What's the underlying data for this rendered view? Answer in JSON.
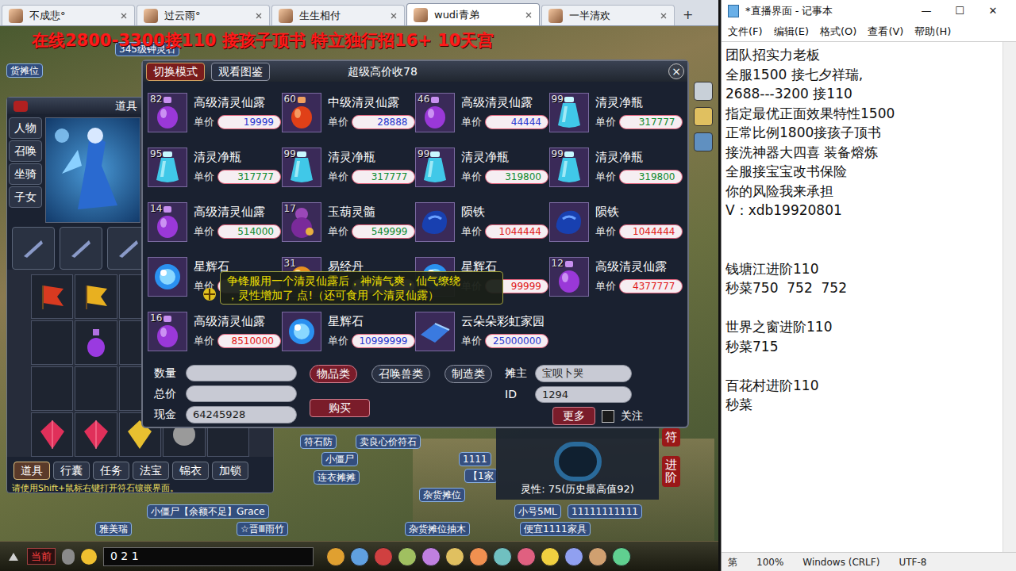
{
  "browser_tabs": [
    {
      "label": "不成悲°",
      "selected": false
    },
    {
      "label": "过云雨°",
      "selected": false
    },
    {
      "label": "生生相付",
      "selected": false
    },
    {
      "label": "wudi青弟",
      "selected": true
    },
    {
      "label": "一半清欢",
      "selected": false
    }
  ],
  "new_tab": "+",
  "banner": "在线2800-3300接110 接孩子顶书 特立独行招16+ 10天宫",
  "scene_labels": [
    "货摊位",
    "345级钟灵石",
    "符石防",
    "卖良心价符石",
    "小僵尸",
    "连衣摊摊",
    "1111",
    "【1家",
    "杂货摊位",
    "小号5ML",
    "11111111111",
    "小僵尸【余额不足】Grace",
    "雅美瑞",
    "☆晋Ⅲ雨竹",
    "杂货摊位抽木",
    "便宜1111家具"
  ],
  "inventory": {
    "title": "道具",
    "side_tabs": [
      "人物",
      "召唤",
      "坐骑",
      "子女"
    ],
    "bottom_tabs": [
      {
        "label": "道具",
        "selected": true
      },
      {
        "label": "行囊",
        "selected": false
      },
      {
        "label": "任务",
        "selected": false
      },
      {
        "label": "法宝",
        "selected": false
      },
      {
        "label": "锦衣",
        "selected": false
      },
      {
        "label": "加锁",
        "selected": false
      }
    ],
    "hint": "请使用Shift+鼠标右键打开符石镶嵌界面。"
  },
  "stall": {
    "mode_button": "切换模式",
    "atlas_button": "观看图鉴",
    "title": "超级高价收78",
    "close": "×",
    "price_label": "单价",
    "items": [
      {
        "count": "82",
        "name": "高级清灵仙露",
        "price": "19999",
        "kind": "purple-bottle",
        "color": "#2838d0"
      },
      {
        "count": "60",
        "name": "中级清灵仙露",
        "price": "28888",
        "kind": "red-bottle",
        "color": "#2838d0"
      },
      {
        "count": "46",
        "name": "高级清灵仙露",
        "price": "44444",
        "kind": "purple-bottle",
        "color": "#2838d0"
      },
      {
        "count": "99",
        "name": "清灵净瓶",
        "price": "317777",
        "kind": "cyan-bottle",
        "color": "#108a30"
      },
      {
        "count": "95",
        "name": "清灵净瓶",
        "price": "317777",
        "kind": "cyan-bottle",
        "color": "#108a30"
      },
      {
        "count": "99",
        "name": "清灵净瓶",
        "price": "317777",
        "kind": "cyan-bottle",
        "color": "#108a30"
      },
      {
        "count": "99",
        "name": "清灵净瓶",
        "price": "319800",
        "kind": "cyan-bottle",
        "color": "#108a30"
      },
      {
        "count": "99",
        "name": "清灵净瓶",
        "price": "319800",
        "kind": "cyan-bottle",
        "color": "#108a30"
      },
      {
        "count": "14",
        "name": "高级清灵仙露",
        "price": "514000",
        "kind": "purple-bottle",
        "color": "#108a30"
      },
      {
        "count": "17",
        "name": "玉葫灵髓",
        "price": "549999",
        "kind": "gourd",
        "color": "#108a30"
      },
      {
        "count": "",
        "name": "陨铁",
        "price": "1044444",
        "kind": "iron",
        "color": "#e01818"
      },
      {
        "count": "",
        "name": "陨铁",
        "price": "1044444",
        "kind": "iron",
        "color": "#e01818"
      },
      {
        "count": "",
        "name": "星辉石",
        "price": "",
        "kind": "star-stone",
        "color": "#2838d0"
      },
      {
        "count": "31",
        "name": "易经丹",
        "price": "",
        "kind": "pill",
        "color": "#2838d0"
      },
      {
        "count": "",
        "name": "星辉石",
        "price": "99999",
        "kind": "star-stone",
        "color": "#e01818"
      },
      {
        "count": "12",
        "name": "高级清灵仙露",
        "price": "4377777",
        "kind": "purple-bottle",
        "color": "#e01818"
      },
      {
        "count": "16",
        "name": "高级清灵仙露",
        "price": "8510000",
        "kind": "purple-bottle",
        "color": "#e01818"
      },
      {
        "count": "",
        "name": "星辉石",
        "price": "10999999",
        "kind": "star-stone",
        "color": "#2838d0"
      },
      {
        "count": "",
        "name": "云朵朵彩虹家园",
        "price": "25000000",
        "kind": "carpet",
        "color": "#2838d0"
      }
    ],
    "tooltip": [
      "争锋服用一个清灵仙露后，神清气爽，仙气缭绕",
      "，灵性增加了 点!（还可食用 个清灵仙露）"
    ],
    "quantity_label": "数量",
    "total_label": "总价",
    "cash_label": "现金",
    "cash": "64245928",
    "category_tabs": [
      {
        "label": "物品类",
        "selected": true
      },
      {
        "label": "召唤兽类",
        "selected": false
      },
      {
        "label": "制造类",
        "selected": false
      }
    ],
    "owner_label": "摊主",
    "owner": "宝呗卜哭",
    "id_label": "ID",
    "id": "1294",
    "buy": "购买",
    "more": "更多",
    "follow_label": "关注",
    "follow": false
  },
  "pet_panel": {
    "spirit": "灵性: 75(历史最高值92)",
    "side_button": "符",
    "advance": "进阶"
  },
  "chat": {
    "channel": "当前",
    "input": "0 2 1"
  },
  "notepad": {
    "title": "*直播界面 - 记事本",
    "controls": [
      "—",
      "☐",
      "✕"
    ],
    "menu": [
      "文件(F)",
      "编辑(E)",
      "格式(O)",
      "查看(V)",
      "帮助(H)"
    ],
    "lines": [
      "团队招实力老板",
      "全服1500 接七夕祥瑞,",
      "2688---3200 接110",
      "指定最优正面效果特性1500",
      "正常比例1800接孩子顶书",
      "接洗神器大四喜 装备熔炼",
      "全服接宝宝改书保险",
      "你的风险我来承担",
      "V：xdb19920801",
      "",
      "",
      "钱塘江进阶110",
      "秒菜750  752  752",
      "",
      "世界之窗进阶110",
      "秒菜715",
      "",
      "百花村进阶110",
      "秒菜"
    ],
    "status_bar": [
      "第",
      "100%",
      "Windows (CRLF)",
      "UTF-8"
    ]
  }
}
